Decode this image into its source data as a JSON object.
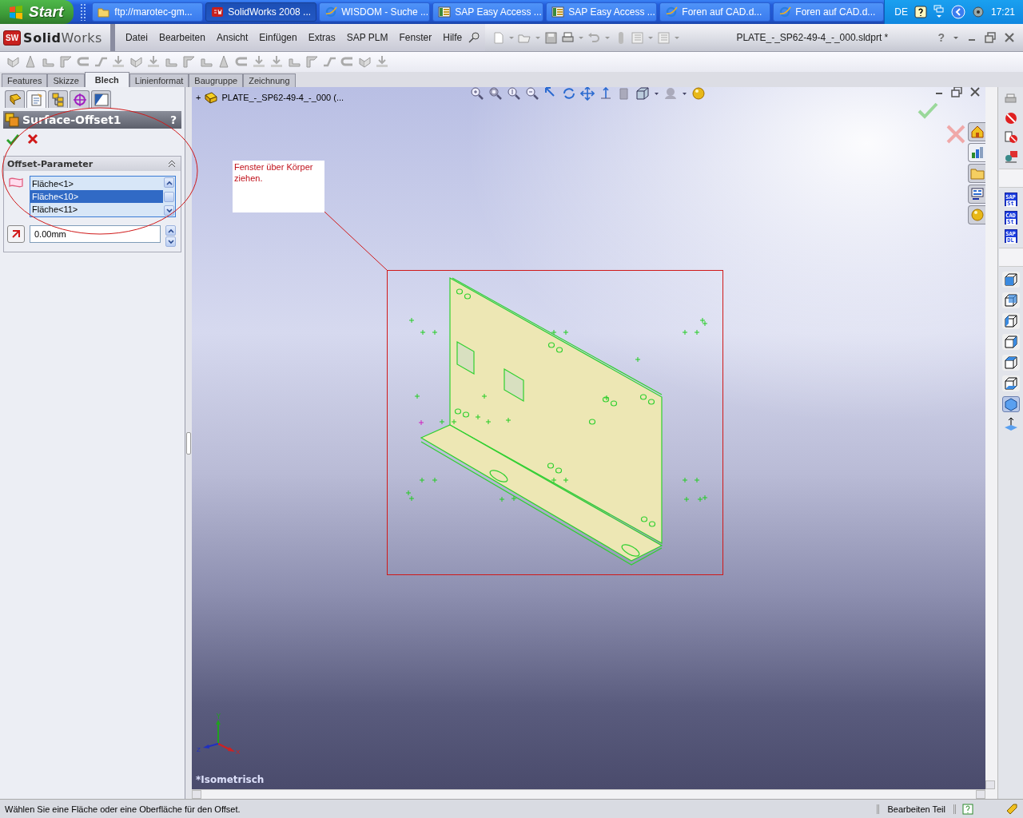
{
  "taskbar": {
    "start": "Start",
    "tasks": [
      {
        "label": "ftp://marotec-gm...",
        "kind": "folder",
        "selected": false
      },
      {
        "label": "SolidWorks 2008 ...",
        "kind": "solidworks",
        "selected": true
      },
      {
        "label": "WISDOM - Suche ...",
        "kind": "browser",
        "selected": false
      },
      {
        "label": "SAP Easy Access ...",
        "kind": "sap",
        "selected": false
      },
      {
        "label": "SAP Easy Access ...",
        "kind": "sap",
        "selected": false
      },
      {
        "label": "Foren auf CAD.d...",
        "kind": "browser",
        "selected": false
      },
      {
        "label": "Foren auf CAD.d...",
        "kind": "browser",
        "selected": false
      }
    ],
    "language": "DE",
    "clock": "17:21"
  },
  "app": {
    "logo_badge": "SW",
    "logo": "**Solid**Works",
    "menus": [
      "Datei",
      "Bearbeiten",
      "Ansicht",
      "Einfügen",
      "Extras",
      "SAP PLM",
      "Fenster",
      "Hilfe"
    ],
    "document_title": "PLATE_-_SP62-49-4_-_000.sldprt *",
    "help": "?"
  },
  "command_tabs": [
    {
      "label": "Features",
      "selected": false
    },
    {
      "label": "Skizze",
      "selected": false
    },
    {
      "label": "Blech",
      "selected": true
    },
    {
      "label": "Linienformat",
      "selected": false
    },
    {
      "label": "Baugruppe",
      "selected": false
    },
    {
      "label": "Zeichnung",
      "selected": false
    }
  ],
  "property_manager": {
    "tabs": [
      {
        "kind": "tree",
        "selected": false
      },
      {
        "kind": "properties",
        "selected": true
      },
      {
        "kind": "configurations",
        "selected": false
      },
      {
        "kind": "target",
        "selected": false
      },
      {
        "kind": "display",
        "selected": false
      }
    ],
    "title": "Surface-Offset1",
    "help": "?",
    "group": {
      "title": "Offset-Parameter",
      "expanded": true,
      "faces": [
        {
          "label": "Fläche<1>",
          "selected": false
        },
        {
          "label": "Fläche<10>",
          "selected": true
        },
        {
          "label": "Fläche<11>",
          "selected": false
        }
      ],
      "distance": "0.00mm"
    }
  },
  "viewport": {
    "tree_expander": "+",
    "tree_item": "PLATE_-_SP62-49-4_-_000 (...",
    "tooltip": "Fenster über Körper ziehen.",
    "triad": {
      "y": "Y",
      "z": "Z",
      "x": "X"
    },
    "view_name": "*Isometrisch",
    "task_pane_tabs": [
      {
        "selected": false
      },
      {
        "selected": true
      },
      {
        "selected": false
      },
      {
        "selected": false
      },
      {
        "selected": false
      }
    ]
  },
  "right_toolbar": {
    "sap_buttons": [
      {
        "top": "SAP",
        "bottom": "St"
      },
      {
        "top": "CAD",
        "bottom": "St"
      },
      {
        "top": "SAP",
        "bottom": "DL"
      }
    ],
    "standard_views": [
      {
        "selected": false
      },
      {
        "selected": false
      },
      {
        "selected": false
      },
      {
        "selected": false
      },
      {
        "selected": false
      },
      {
        "selected": false
      },
      {
        "selected": true
      }
    ]
  },
  "status_bar": {
    "message": "Wählen Sie eine Fläche oder eine Oberfläche für den Offset.",
    "mode": "Bearbeiten Teil"
  }
}
